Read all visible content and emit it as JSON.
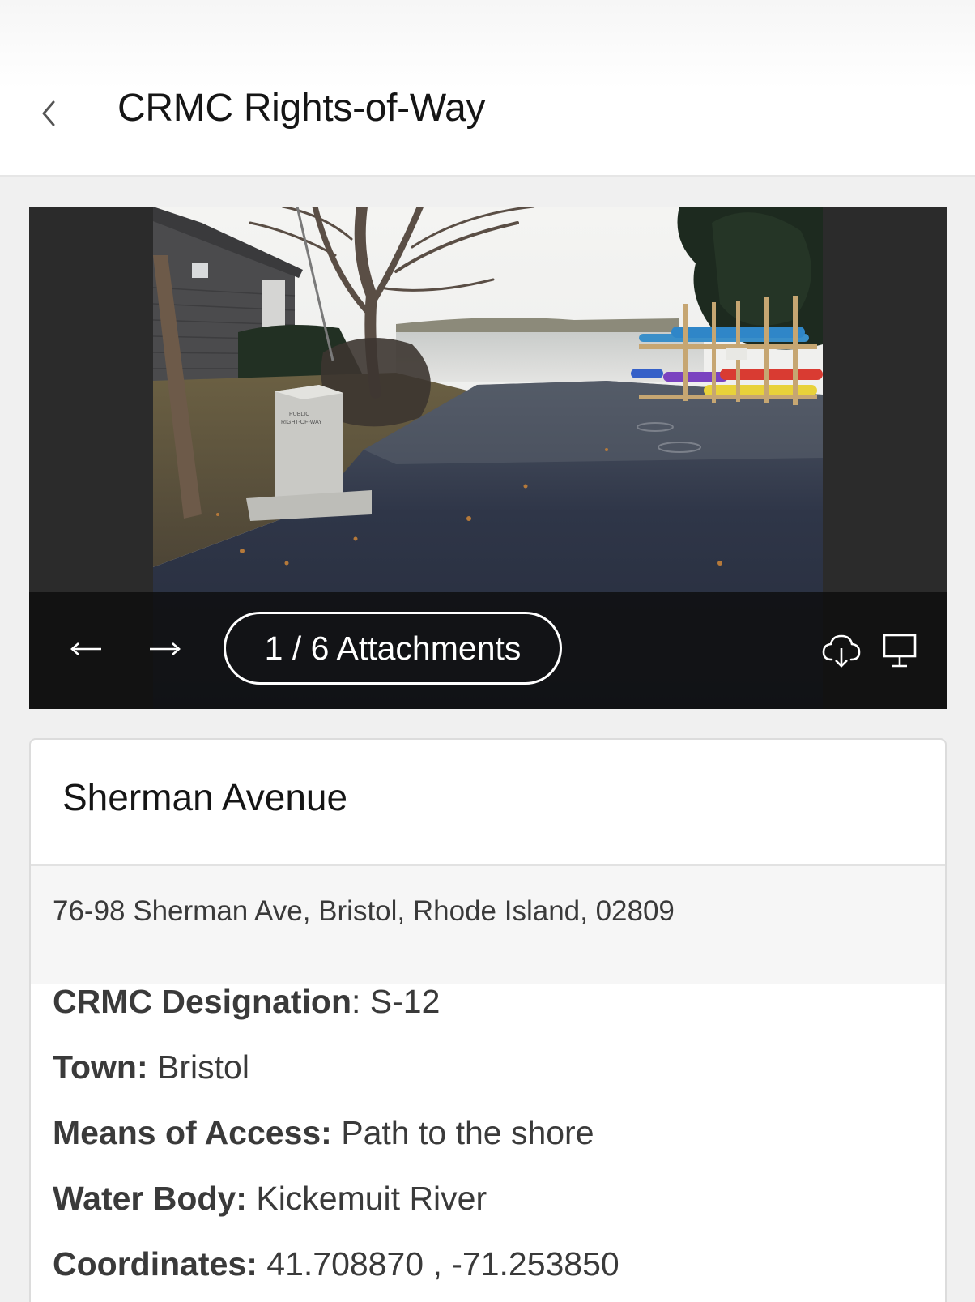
{
  "header": {
    "title": "CRMC Rights-of-Way"
  },
  "viewer": {
    "photo_text": "PUBLIC\nRIGHT-OF-WAY",
    "attachments_label": "1 / 6 Attachments"
  },
  "card": {
    "title": "Sherman Avenue",
    "address": "76-98 Sherman Ave, Bristol, Rhode Island, 02809",
    "fields": [
      {
        "label": "CRMC Designation",
        "sep": ": ",
        "value": "S-12"
      },
      {
        "label": "Town:",
        "sep": " ",
        "value": "Bristol"
      },
      {
        "label": "Means of Access:",
        "sep": " ",
        "value": "Path to the shore"
      },
      {
        "label": "Water Body:",
        "sep": " ",
        "value": "Kickemuit River"
      },
      {
        "label": "Coordinates:",
        "sep": " ",
        "value": "41.708870 , -71.253850"
      }
    ]
  },
  "colors": {
    "viewer_background": "#2b2b2b",
    "viewer_bar": "#0e0e0e",
    "card_border": "#dcdcdc"
  },
  "icons": {
    "back": "chevron-left-icon",
    "prev": "arrow-left-icon",
    "next": "arrow-right-icon",
    "download": "cloud-download-icon",
    "present": "presentation-icon"
  }
}
